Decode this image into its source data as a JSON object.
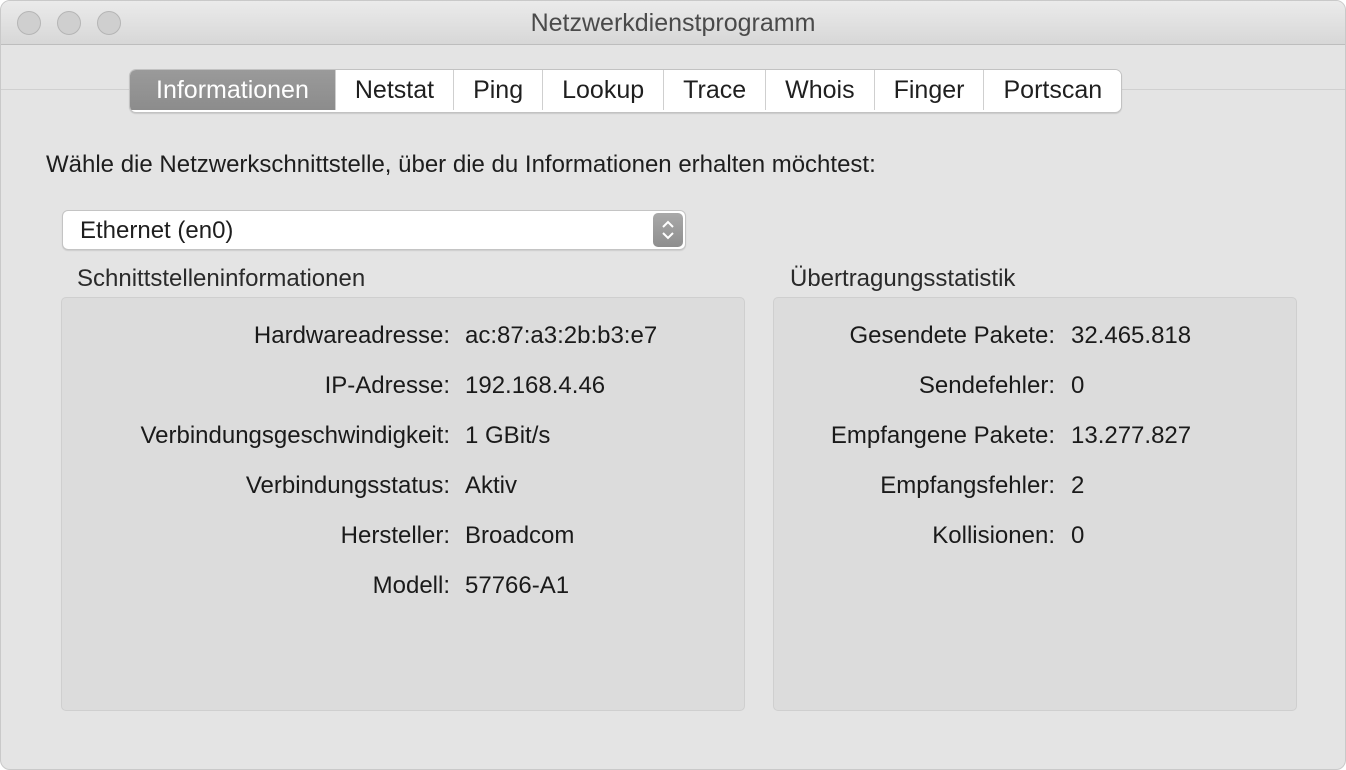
{
  "window": {
    "title": "Netzwerkdienstprogramm"
  },
  "tabs": [
    {
      "label": "Informationen",
      "active": true
    },
    {
      "label": "Netstat",
      "active": false
    },
    {
      "label": "Ping",
      "active": false
    },
    {
      "label": "Lookup",
      "active": false
    },
    {
      "label": "Trace",
      "active": false
    },
    {
      "label": "Whois",
      "active": false
    },
    {
      "label": "Finger",
      "active": false
    },
    {
      "label": "Portscan",
      "active": false
    }
  ],
  "prompt": "Wähle die Netzwerkschnittstelle, über die du Informationen erhalten möchtest:",
  "interface_select": {
    "value": "Ethernet (en0)"
  },
  "interface_info": {
    "title": "Schnittstelleninformationen",
    "rows": [
      {
        "label": "Hardwareadresse:",
        "value": "ac:87:a3:2b:b3:e7"
      },
      {
        "label": "IP-Adresse:",
        "value": "192.168.4.46"
      },
      {
        "label": "Verbindungsgeschwindigkeit:",
        "value": "1 GBit/s"
      },
      {
        "label": "Verbindungsstatus:",
        "value": "Aktiv"
      },
      {
        "label": "Hersteller:",
        "value": "Broadcom"
      },
      {
        "label": "Modell:",
        "value": "57766-A1"
      }
    ]
  },
  "transfer_stats": {
    "title": "Übertragungsstatistik",
    "rows": [
      {
        "label": "Gesendete Pakete:",
        "value": "32.465.818"
      },
      {
        "label": "Sendefehler:",
        "value": "0"
      },
      {
        "label": "Empfangene Pakete:",
        "value": "13.277.827"
      },
      {
        "label": "Empfangsfehler:",
        "value": "2"
      },
      {
        "label": "Kollisionen:",
        "value": "0"
      }
    ]
  }
}
